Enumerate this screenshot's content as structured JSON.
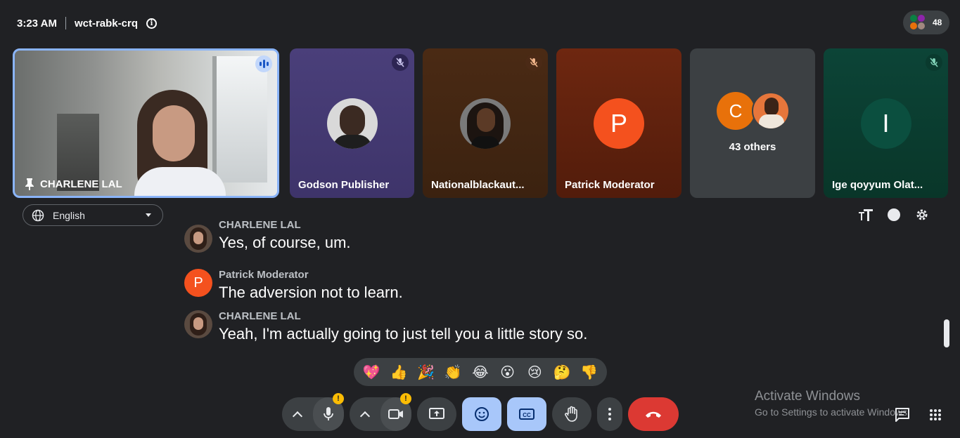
{
  "meeting": {
    "time": "3:23 AM",
    "code": "wct-rabk-crq",
    "participant_count": "48"
  },
  "tiles": {
    "pinned": {
      "name": "CHARLENE LAL"
    },
    "t1": {
      "name": "Godson Publisher"
    },
    "t2": {
      "name": "Nationalblackaut..."
    },
    "t3": {
      "name": "Patrick Moderator",
      "initial": "P"
    },
    "t4": {
      "initial": "C",
      "label": "43 others"
    },
    "t5": {
      "name": "Ige qoyyum Olat...",
      "initial": "I"
    }
  },
  "captions_bar": {
    "language": "English"
  },
  "captions": [
    {
      "speaker": "CHARLENE LAL",
      "text": "Yes, of course, um."
    },
    {
      "speaker": "Patrick Moderator",
      "initial": "P",
      "text": "The adversion not to learn."
    },
    {
      "speaker": "CHARLENE LAL",
      "text": "Yeah, I'm actually going to just tell you a little story so."
    }
  ],
  "reactions": [
    "💖",
    "👍",
    "🎉",
    "👏",
    "😂",
    "😮",
    "😢",
    "🤔",
    "👎"
  ],
  "controls": {
    "mic_warning": "!",
    "camera_warning": "!"
  },
  "watermark": {
    "title": "Activate Windows",
    "subtitle": "Go to Settings to activate Windows."
  },
  "colors": {
    "accent_blue": "#8ab4f8",
    "control_bg": "#3c4043",
    "end_call_red": "#dc3933",
    "patrick_orange": "#f4511e",
    "c_orange": "#e8710a",
    "ige_green": "#0b4f3f"
  }
}
